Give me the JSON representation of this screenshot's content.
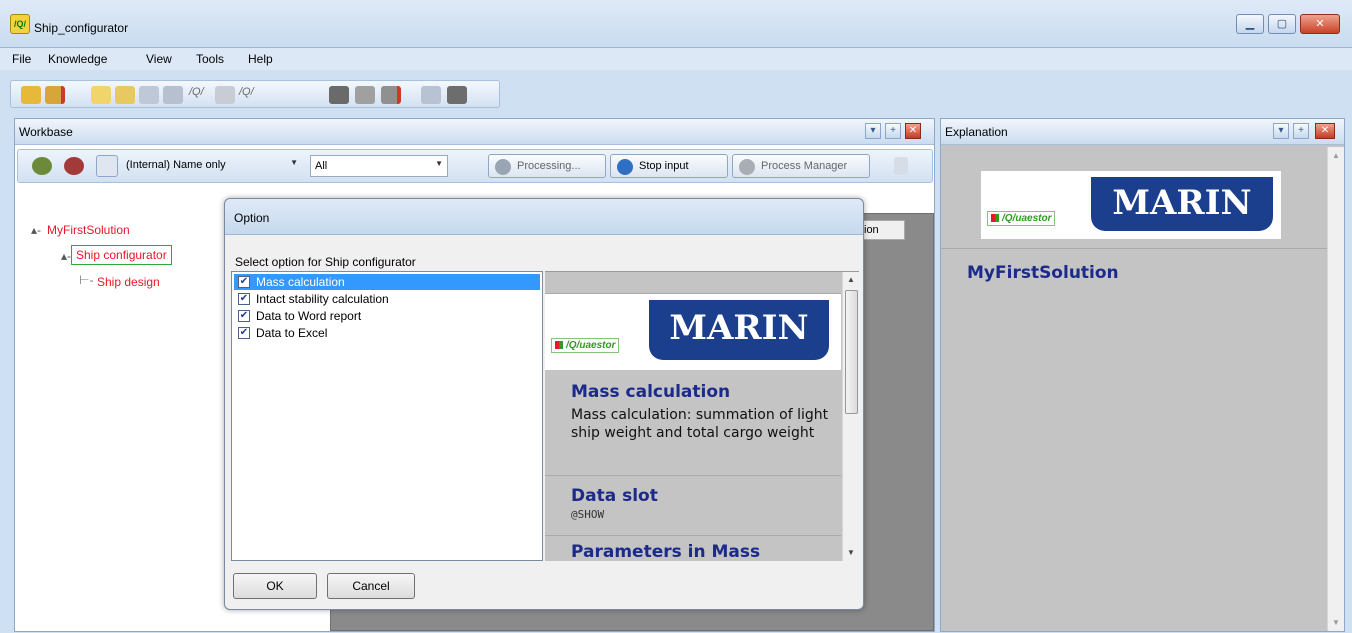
{
  "window": {
    "title": "Ship_configurator"
  },
  "menu": [
    "File",
    "Knowledge",
    "View",
    "Tools",
    "Help"
  ],
  "workbase": {
    "title": "Workbase",
    "combo_name": "(Internal) Name only",
    "combo_filter": "All",
    "processing_label": "Processing...",
    "stop_input_label": "Stop input",
    "process_manager_label": "Process Manager"
  },
  "tree": {
    "root": "MyFirstSolution",
    "child": "Ship configurator",
    "grandchild": "Ship design"
  },
  "hidden_tab_fragment": "ion",
  "dialog": {
    "title": "Option",
    "prompt": "Select option for Ship configurator",
    "options": [
      {
        "label": "Mass calculation",
        "checked": true,
        "selected": true
      },
      {
        "label": "Intact stability calculation",
        "checked": true,
        "selected": false
      },
      {
        "label": "Data to Word report",
        "checked": true,
        "selected": false
      },
      {
        "label": "Data to Excel",
        "checked": true,
        "selected": false
      }
    ],
    "info": {
      "logo_quaestor": "/Q/uaestor",
      "logo_marin": "MARIN",
      "section1_title": "Mass calculation",
      "section1_text": "Mass calculation: summation of light ship weight and total cargo weight",
      "section2_title": "Data slot",
      "section2_text": "@SHOW",
      "section3_title": "Parameters in Mass"
    },
    "ok_label": "OK",
    "cancel_label": "Cancel"
  },
  "explanation": {
    "title": "Explanation",
    "logo_quaestor": "/Q/uaestor",
    "logo_marin": "MARIN",
    "heading": "MyFirstSolution"
  },
  "colors": {
    "tree_red": "#e8172a",
    "heading_blue": "#1c2a8a",
    "marin_blue": "#1c3f8d",
    "selection": "#3399ff"
  }
}
